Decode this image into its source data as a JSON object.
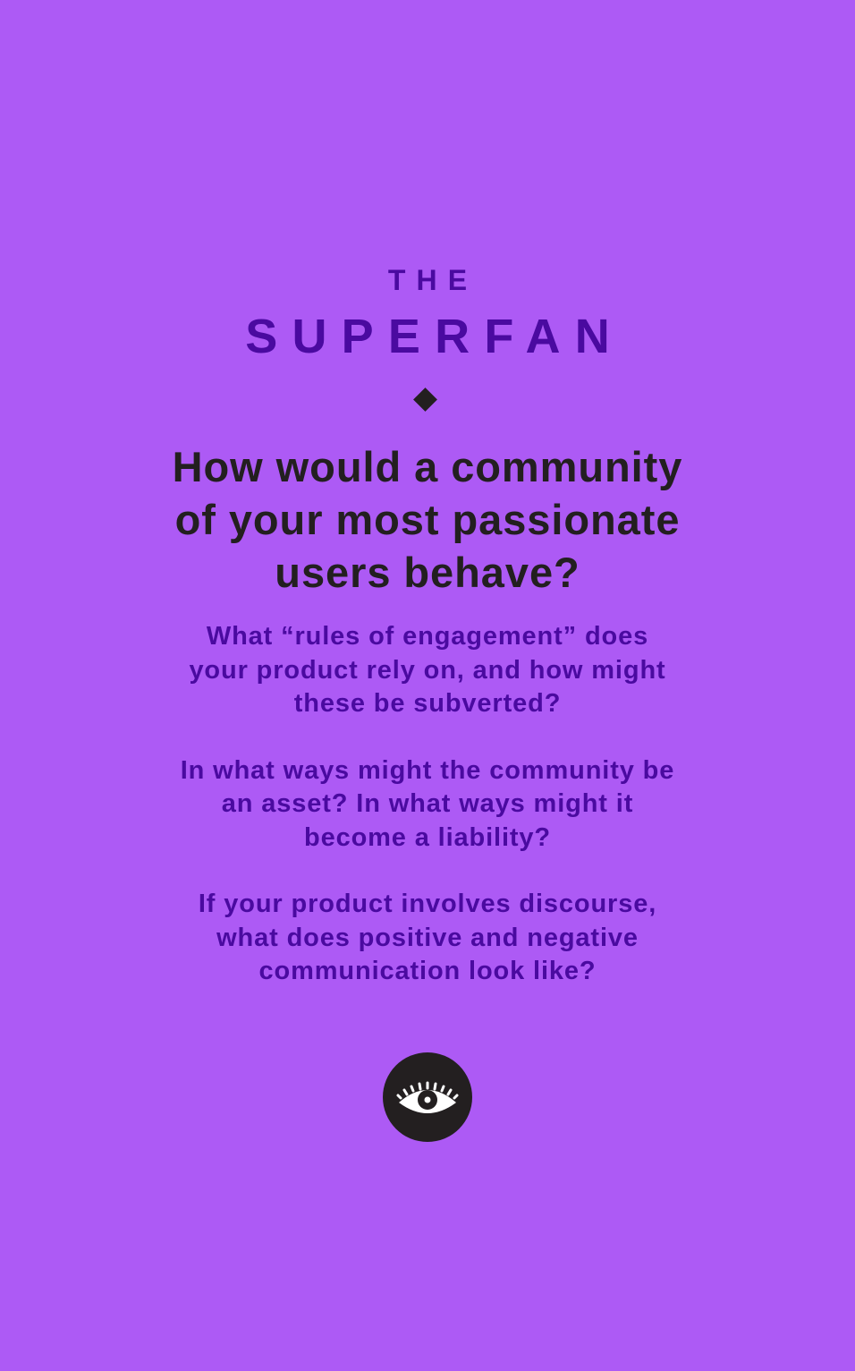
{
  "card": {
    "kicker": "THE",
    "title": "SUPERFAN",
    "headline_lines": [
      "How would a community",
      "of your most passionate",
      "users behave?"
    ],
    "questions": [
      {
        "lines": [
          "What “rules of engagement” does",
          "your product rely on, and how might",
          "these be subverted?"
        ]
      },
      {
        "lines": [
          "In what ways might the community be",
          "an asset? In what ways might it",
          "become a liability?"
        ]
      },
      {
        "lines": [
          "If your product involves discourse,",
          "what does positive and negative",
          "communication look like?"
        ]
      }
    ],
    "icon": "eye-icon",
    "colors": {
      "background": "#ad5af5",
      "accent": "#4a0aa0",
      "dark": "#231f20"
    }
  }
}
